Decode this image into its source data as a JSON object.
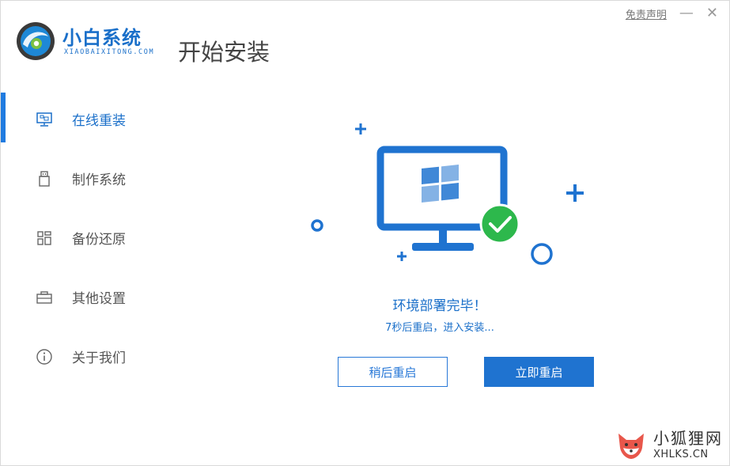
{
  "app": {
    "brand_name": "小白系统",
    "brand_sub": "XIAOBAIXITONG.COM",
    "page_title": "开始安装"
  },
  "window": {
    "disclaimer": "免责声明",
    "minimize": "—",
    "close": "✕"
  },
  "sidebar": {
    "items": [
      {
        "label": "在线重装",
        "icon": "monitor-icon",
        "active": true
      },
      {
        "label": "制作系统",
        "icon": "usb-drive-icon",
        "active": false
      },
      {
        "label": "备份还原",
        "icon": "grid-icon",
        "active": false
      },
      {
        "label": "其他设置",
        "icon": "toolbox-icon",
        "active": false
      },
      {
        "label": "关于我们",
        "icon": "info-icon",
        "active": false
      }
    ]
  },
  "main": {
    "status_title": "环境部署完毕！",
    "status_sub": "7秒后重启，进入安装...",
    "later_button": "稍后重启",
    "now_button": "立即重启"
  },
  "watermark": {
    "cn": "小狐狸网",
    "en": "XHLKS.CN"
  },
  "colors": {
    "accent": "#1f73d0",
    "success": "#2db84c"
  }
}
